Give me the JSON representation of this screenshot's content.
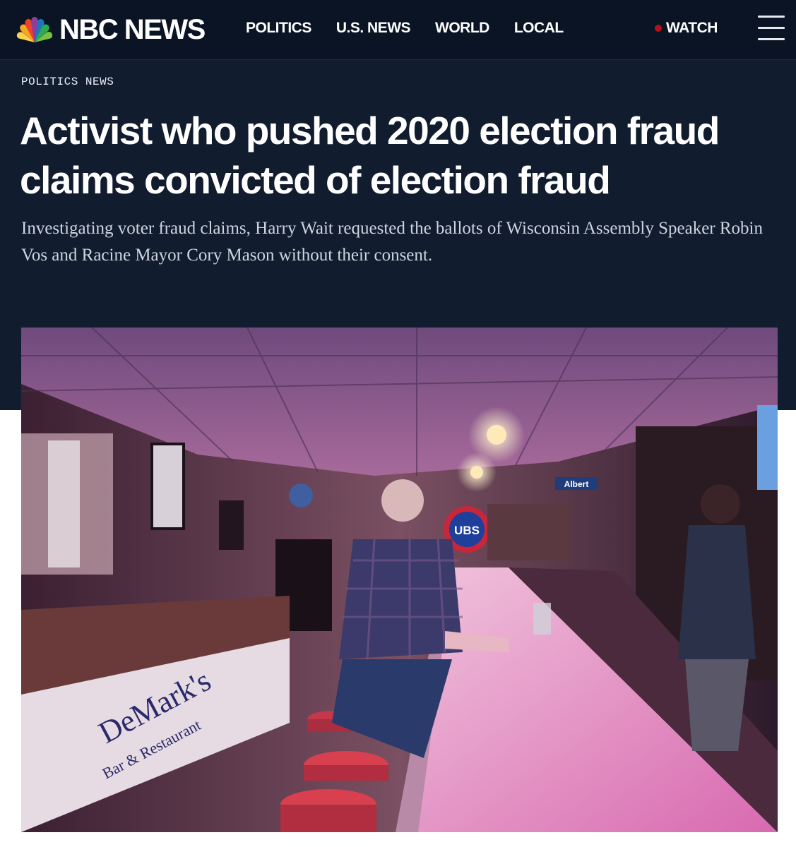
{
  "nav": {
    "logo_text": "NBC NEWS",
    "links": [
      "POLITICS",
      "U.S. NEWS",
      "WORLD",
      "LOCAL"
    ],
    "watch_label": "WATCH",
    "menu_icon": "hamburger-menu-icon"
  },
  "article": {
    "eyebrow": "POLITICS NEWS",
    "headline": "Activist who pushed 2020 election fraud claims convicted of election fraud",
    "dek": "Investigating voter fraud claims, Harry Wait requested the ballots of Wisconsin Assembly Speaker Robin Vos and Racine Mayor Cory Mason without their consent."
  },
  "photo": {
    "signs": {
      "street_sign": "Albert",
      "cubs_logo": "UBS",
      "bar_name": "DeMark's",
      "bar_subtitle": "Bar & Restaurant"
    }
  },
  "colors": {
    "nav_bg": "#0b1424",
    "hero_bg": "#111c2f",
    "watch_dot": "#b3121b"
  }
}
